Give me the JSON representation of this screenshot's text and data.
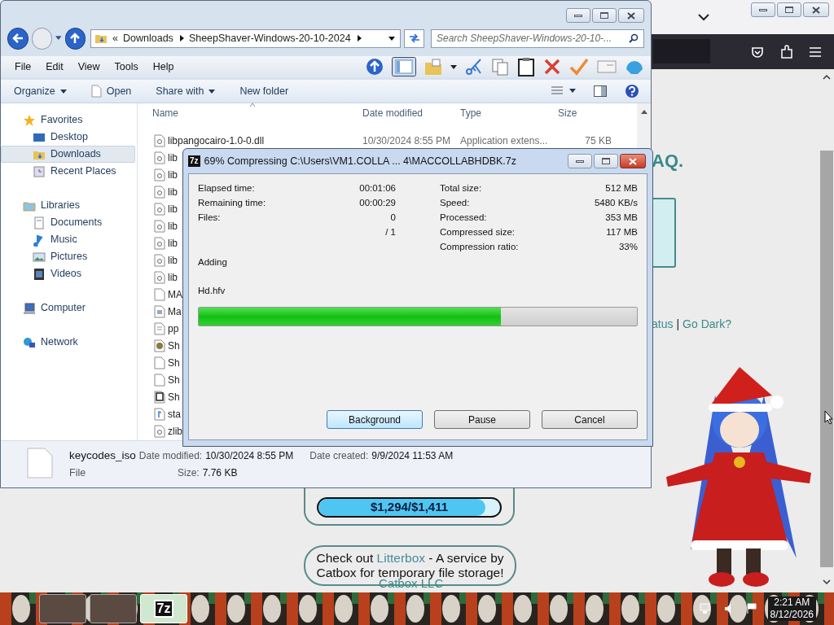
{
  "browser": {
    "page": {
      "heading": "AQ.",
      "links_line": {
        "before": "atus",
        "separator": "|",
        "link": "Go Dark?"
      },
      "donation": {
        "reading": "$1,294/$1,411",
        "level": 0.92
      },
      "promo": {
        "before": "Check out ",
        "link": "Litterbox",
        "after": " - A service by Catbox for temporary file storage!"
      },
      "footer": "Catbox LLC"
    }
  },
  "explorer": {
    "breadcrumb_prefix": "«",
    "breadcrumb": [
      "Downloads",
      "SheepShaver-Windows-20-10-2024"
    ],
    "search": {
      "placeholder": "Search SheepShaver-Windows-20-10-..."
    },
    "menu": [
      "File",
      "Edit",
      "View",
      "Tools",
      "Help"
    ],
    "commands": [
      {
        "label": "Organize",
        "dropdown": true
      },
      {
        "label": "Open",
        "dropdown": false
      },
      {
        "label": "Share with",
        "dropdown": true
      },
      {
        "label": "New folder",
        "dropdown": false
      }
    ],
    "nav": [
      {
        "label": "Favorites",
        "kind": "star",
        "selected": false,
        "children": [
          {
            "label": "Desktop",
            "kind": "desktop",
            "selected": false
          },
          {
            "label": "Downloads",
            "kind": "downloads",
            "selected": true
          },
          {
            "label": "Recent Places",
            "kind": "recent",
            "selected": false
          }
        ]
      },
      {
        "label": "Libraries",
        "kind": "library",
        "selected": false,
        "children": [
          {
            "label": "Documents",
            "kind": "documents",
            "selected": false
          },
          {
            "label": "Music",
            "kind": "music",
            "selected": false
          },
          {
            "label": "Pictures",
            "kind": "pictures",
            "selected": false
          },
          {
            "label": "Videos",
            "kind": "videos",
            "selected": false
          }
        ]
      },
      {
        "label": "Computer",
        "kind": "computer",
        "selected": false
      },
      {
        "label": "Network",
        "kind": "network",
        "selected": false
      }
    ],
    "columns": [
      "Name",
      "Date modified",
      "Type",
      "Size"
    ],
    "rows": [
      {
        "name": "libpangocairo-1.0-0.dll",
        "date": "10/30/2024 8:55 PM",
        "type": "Application extens...",
        "size": "75 KB",
        "kind": "dll"
      },
      {
        "name": "lib",
        "kind": "dll"
      },
      {
        "name": "lib",
        "kind": "dll"
      },
      {
        "name": "lib",
        "kind": "dll"
      },
      {
        "name": "lib",
        "kind": "dll"
      },
      {
        "name": "lib",
        "kind": "dll"
      },
      {
        "name": "lib",
        "kind": "dll"
      },
      {
        "name": "lib",
        "kind": "dll"
      },
      {
        "name": "lib",
        "kind": "dll"
      },
      {
        "name": "MA",
        "kind": "blank"
      },
      {
        "name": "Ma",
        "kind": "app"
      },
      {
        "name": "pp",
        "kind": "text"
      },
      {
        "name": "Sh",
        "kind": "sheep"
      },
      {
        "name": "Sh",
        "kind": "blank"
      },
      {
        "name": "Sh",
        "kind": "blank"
      },
      {
        "name": "Sh",
        "kind": "mac"
      },
      {
        "name": "sta",
        "kind": "audio"
      },
      {
        "name": "zlib",
        "kind": "dll"
      }
    ],
    "details": {
      "name": "keycodes_iso",
      "type": "File",
      "fields": [
        {
          "label": "Date modified:",
          "value": "10/30/2024 8:55 PM"
        },
        {
          "label": "Date created:",
          "value": "9/9/2024 11:53 AM"
        },
        {
          "label": "Size:",
          "value": "7.76 KB"
        }
      ]
    }
  },
  "dialog": {
    "icon_text": "7z",
    "title": "69% Compressing C:\\Users\\VM1.COLLA ... 4\\MACCOLLABHDBK.7z",
    "left_stats": [
      {
        "label": "Elapsed time:",
        "value": "00:01:06"
      },
      {
        "label": "Remaining time:",
        "value": "00:00:29"
      },
      {
        "label": "Files:",
        "value": "0"
      },
      {
        "value": "/ 1"
      }
    ],
    "right_stats": [
      {
        "label": "Total size:",
        "value": "512 MB"
      },
      {
        "label": "Speed:",
        "value": "5480 KB/s"
      },
      {
        "label": "Processed:",
        "value": "353 MB"
      },
      {
        "label": "Compressed size:",
        "value": "117 MB"
      },
      {
        "label": "Compression ratio:",
        "value": "33%"
      }
    ],
    "operation": "Adding",
    "file": "Hd.hfv",
    "progress": {
      "level": 0.69
    },
    "buttons": [
      {
        "label": "Background",
        "selected": true
      },
      {
        "label": "Pause",
        "selected": false
      },
      {
        "label": "Cancel",
        "selected": false
      }
    ]
  },
  "taskbar": {
    "buttons": [
      {
        "kind": "thumbnail",
        "selected": false
      },
      {
        "kind": "thumbnail",
        "selected": false
      },
      {
        "kind": "app",
        "text": "7z",
        "selected": true
      }
    ],
    "time": "2:21 AM",
    "date": "8/12/2026"
  }
}
